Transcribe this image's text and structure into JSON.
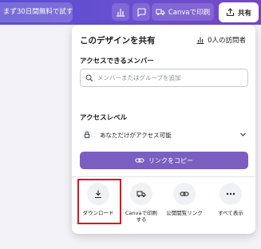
{
  "topbar": {
    "trial_label": "まず30日間無料で試す",
    "print_label": "Canvaで印刷",
    "share_label": "共有",
    "icons": [
      "analytics-icon",
      "comment-icon",
      "truck-icon",
      "share-upload-icon"
    ]
  },
  "panel": {
    "title": "このデザインを共有",
    "visitors": "0人の訪問者",
    "members_label": "アクセスできるメンバー",
    "search_placeholder": "メンバーまたはグループを追加",
    "access_level_label": "アクセスレベル",
    "access_value": "あなただけがアクセス可能",
    "copy_link_label": "リンクをコピー",
    "actions": [
      {
        "label": "ダウンロード",
        "icon": "download-icon"
      },
      {
        "label": "Canvaで印刷する",
        "icon": "truck-icon"
      },
      {
        "label": "公開閲覧リンク",
        "icon": "link-icon"
      },
      {
        "label": "すべて表示",
        "icon": "more-icon"
      }
    ]
  },
  "colors": {
    "topbar_start": "#5b4ed3",
    "topbar_end": "#7348c9",
    "copy_button": "#7b5fc0",
    "highlight": "#d9181e"
  }
}
